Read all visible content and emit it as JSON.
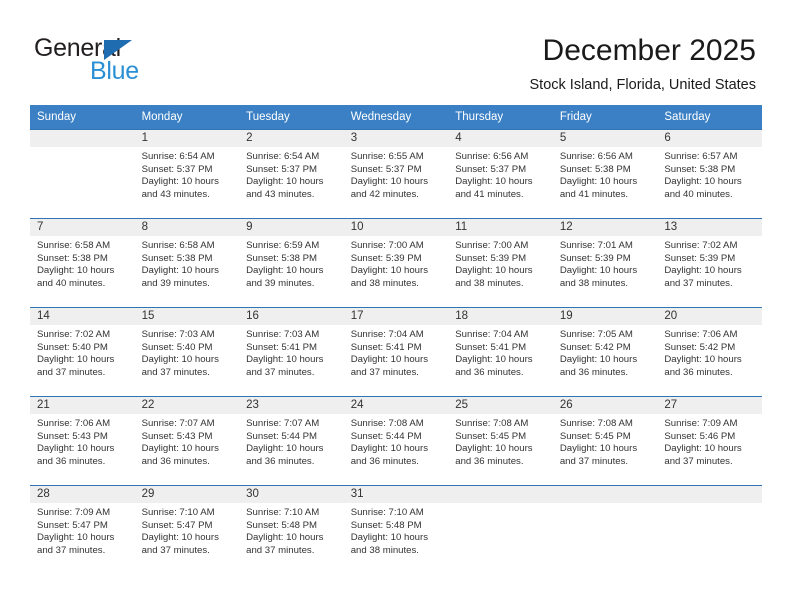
{
  "brand": {
    "name_top": "General",
    "name_bottom": "Blue",
    "triangle_color": "#1f6cb0",
    "blue_text_color": "#2a8fd4"
  },
  "header": {
    "title": "December 2025",
    "subtitle": "Stock Island, Florida, United States"
  },
  "theme": {
    "header_bg": "#3b80c4",
    "row_border": "#2f74b5",
    "daynum_bg": "#efefef",
    "text": "#333333"
  },
  "calendar": {
    "weekday_headers": [
      "Sunday",
      "Monday",
      "Tuesday",
      "Wednesday",
      "Thursday",
      "Friday",
      "Saturday"
    ],
    "weeks": [
      [
        {
          "day": "",
          "sunrise": "",
          "sunset": "",
          "daylight_1": "",
          "daylight_2": "",
          "empty": true
        },
        {
          "day": "1",
          "sunrise": "Sunrise: 6:54 AM",
          "sunset": "Sunset: 5:37 PM",
          "daylight_1": "Daylight: 10 hours",
          "daylight_2": "and 43 minutes."
        },
        {
          "day": "2",
          "sunrise": "Sunrise: 6:54 AM",
          "sunset": "Sunset: 5:37 PM",
          "daylight_1": "Daylight: 10 hours",
          "daylight_2": "and 43 minutes."
        },
        {
          "day": "3",
          "sunrise": "Sunrise: 6:55 AM",
          "sunset": "Sunset: 5:37 PM",
          "daylight_1": "Daylight: 10 hours",
          "daylight_2": "and 42 minutes."
        },
        {
          "day": "4",
          "sunrise": "Sunrise: 6:56 AM",
          "sunset": "Sunset: 5:37 PM",
          "daylight_1": "Daylight: 10 hours",
          "daylight_2": "and 41 minutes."
        },
        {
          "day": "5",
          "sunrise": "Sunrise: 6:56 AM",
          "sunset": "Sunset: 5:38 PM",
          "daylight_1": "Daylight: 10 hours",
          "daylight_2": "and 41 minutes."
        },
        {
          "day": "6",
          "sunrise": "Sunrise: 6:57 AM",
          "sunset": "Sunset: 5:38 PM",
          "daylight_1": "Daylight: 10 hours",
          "daylight_2": "and 40 minutes."
        }
      ],
      [
        {
          "day": "7",
          "sunrise": "Sunrise: 6:58 AM",
          "sunset": "Sunset: 5:38 PM",
          "daylight_1": "Daylight: 10 hours",
          "daylight_2": "and 40 minutes."
        },
        {
          "day": "8",
          "sunrise": "Sunrise: 6:58 AM",
          "sunset": "Sunset: 5:38 PM",
          "daylight_1": "Daylight: 10 hours",
          "daylight_2": "and 39 minutes."
        },
        {
          "day": "9",
          "sunrise": "Sunrise: 6:59 AM",
          "sunset": "Sunset: 5:38 PM",
          "daylight_1": "Daylight: 10 hours",
          "daylight_2": "and 39 minutes."
        },
        {
          "day": "10",
          "sunrise": "Sunrise: 7:00 AM",
          "sunset": "Sunset: 5:39 PM",
          "daylight_1": "Daylight: 10 hours",
          "daylight_2": "and 38 minutes."
        },
        {
          "day": "11",
          "sunrise": "Sunrise: 7:00 AM",
          "sunset": "Sunset: 5:39 PM",
          "daylight_1": "Daylight: 10 hours",
          "daylight_2": "and 38 minutes."
        },
        {
          "day": "12",
          "sunrise": "Sunrise: 7:01 AM",
          "sunset": "Sunset: 5:39 PM",
          "daylight_1": "Daylight: 10 hours",
          "daylight_2": "and 38 minutes."
        },
        {
          "day": "13",
          "sunrise": "Sunrise: 7:02 AM",
          "sunset": "Sunset: 5:39 PM",
          "daylight_1": "Daylight: 10 hours",
          "daylight_2": "and 37 minutes."
        }
      ],
      [
        {
          "day": "14",
          "sunrise": "Sunrise: 7:02 AM",
          "sunset": "Sunset: 5:40 PM",
          "daylight_1": "Daylight: 10 hours",
          "daylight_2": "and 37 minutes."
        },
        {
          "day": "15",
          "sunrise": "Sunrise: 7:03 AM",
          "sunset": "Sunset: 5:40 PM",
          "daylight_1": "Daylight: 10 hours",
          "daylight_2": "and 37 minutes."
        },
        {
          "day": "16",
          "sunrise": "Sunrise: 7:03 AM",
          "sunset": "Sunset: 5:41 PM",
          "daylight_1": "Daylight: 10 hours",
          "daylight_2": "and 37 minutes."
        },
        {
          "day": "17",
          "sunrise": "Sunrise: 7:04 AM",
          "sunset": "Sunset: 5:41 PM",
          "daylight_1": "Daylight: 10 hours",
          "daylight_2": "and 37 minutes."
        },
        {
          "day": "18",
          "sunrise": "Sunrise: 7:04 AM",
          "sunset": "Sunset: 5:41 PM",
          "daylight_1": "Daylight: 10 hours",
          "daylight_2": "and 36 minutes."
        },
        {
          "day": "19",
          "sunrise": "Sunrise: 7:05 AM",
          "sunset": "Sunset: 5:42 PM",
          "daylight_1": "Daylight: 10 hours",
          "daylight_2": "and 36 minutes."
        },
        {
          "day": "20",
          "sunrise": "Sunrise: 7:06 AM",
          "sunset": "Sunset: 5:42 PM",
          "daylight_1": "Daylight: 10 hours",
          "daylight_2": "and 36 minutes."
        }
      ],
      [
        {
          "day": "21",
          "sunrise": "Sunrise: 7:06 AM",
          "sunset": "Sunset: 5:43 PM",
          "daylight_1": "Daylight: 10 hours",
          "daylight_2": "and 36 minutes."
        },
        {
          "day": "22",
          "sunrise": "Sunrise: 7:07 AM",
          "sunset": "Sunset: 5:43 PM",
          "daylight_1": "Daylight: 10 hours",
          "daylight_2": "and 36 minutes."
        },
        {
          "day": "23",
          "sunrise": "Sunrise: 7:07 AM",
          "sunset": "Sunset: 5:44 PM",
          "daylight_1": "Daylight: 10 hours",
          "daylight_2": "and 36 minutes."
        },
        {
          "day": "24",
          "sunrise": "Sunrise: 7:08 AM",
          "sunset": "Sunset: 5:44 PM",
          "daylight_1": "Daylight: 10 hours",
          "daylight_2": "and 36 minutes."
        },
        {
          "day": "25",
          "sunrise": "Sunrise: 7:08 AM",
          "sunset": "Sunset: 5:45 PM",
          "daylight_1": "Daylight: 10 hours",
          "daylight_2": "and 36 minutes."
        },
        {
          "day": "26",
          "sunrise": "Sunrise: 7:08 AM",
          "sunset": "Sunset: 5:45 PM",
          "daylight_1": "Daylight: 10 hours",
          "daylight_2": "and 37 minutes."
        },
        {
          "day": "27",
          "sunrise": "Sunrise: 7:09 AM",
          "sunset": "Sunset: 5:46 PM",
          "daylight_1": "Daylight: 10 hours",
          "daylight_2": "and 37 minutes."
        }
      ],
      [
        {
          "day": "28",
          "sunrise": "Sunrise: 7:09 AM",
          "sunset": "Sunset: 5:47 PM",
          "daylight_1": "Daylight: 10 hours",
          "daylight_2": "and 37 minutes."
        },
        {
          "day": "29",
          "sunrise": "Sunrise: 7:10 AM",
          "sunset": "Sunset: 5:47 PM",
          "daylight_1": "Daylight: 10 hours",
          "daylight_2": "and 37 minutes."
        },
        {
          "day": "30",
          "sunrise": "Sunrise: 7:10 AM",
          "sunset": "Sunset: 5:48 PM",
          "daylight_1": "Daylight: 10 hours",
          "daylight_2": "and 37 minutes."
        },
        {
          "day": "31",
          "sunrise": "Sunrise: 7:10 AM",
          "sunset": "Sunset: 5:48 PM",
          "daylight_1": "Daylight: 10 hours",
          "daylight_2": "and 38 minutes."
        },
        {
          "day": "",
          "sunrise": "",
          "sunset": "",
          "daylight_1": "",
          "daylight_2": "",
          "empty": true
        },
        {
          "day": "",
          "sunrise": "",
          "sunset": "",
          "daylight_1": "",
          "daylight_2": "",
          "empty": true
        },
        {
          "day": "",
          "sunrise": "",
          "sunset": "",
          "daylight_1": "",
          "daylight_2": "",
          "empty": true
        }
      ]
    ]
  }
}
